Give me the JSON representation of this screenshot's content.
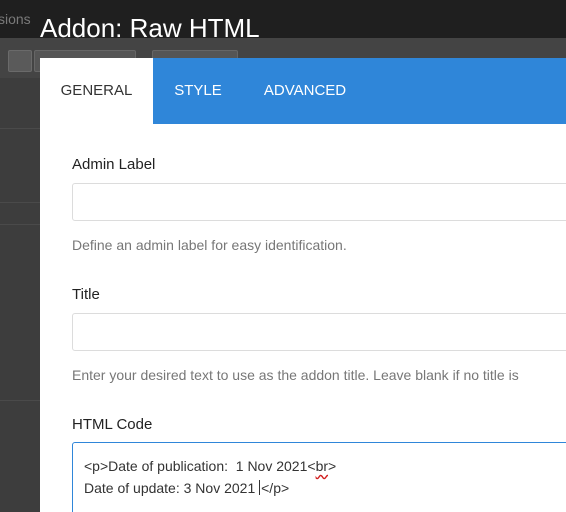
{
  "background": {
    "topbar_text": "sions"
  },
  "modal": {
    "title": "Addon: Raw HTML",
    "tabs": [
      {
        "label": "GENERAL",
        "active": true
      },
      {
        "label": "STYLE",
        "active": false
      },
      {
        "label": "ADVANCED",
        "active": false
      }
    ],
    "fields": {
      "admin_label": {
        "label": "Admin Label",
        "value": "",
        "help": "Define an admin label for easy identification."
      },
      "title": {
        "label": "Title",
        "value": "",
        "help": "Enter your desired text to use as the addon title. Leave blank if no title is"
      },
      "html_code": {
        "label": "HTML Code",
        "line1_before": "<p>Date of publication:  1 Nov 2021<",
        "line1_misspelled": "br",
        "line1_after": ">",
        "line2_before": "Date of update: 3 Nov 2021 ",
        "line2_after": "</p>"
      }
    }
  },
  "colors": {
    "accent": "#2f86d9",
    "overlay": "#3a3a3a"
  }
}
